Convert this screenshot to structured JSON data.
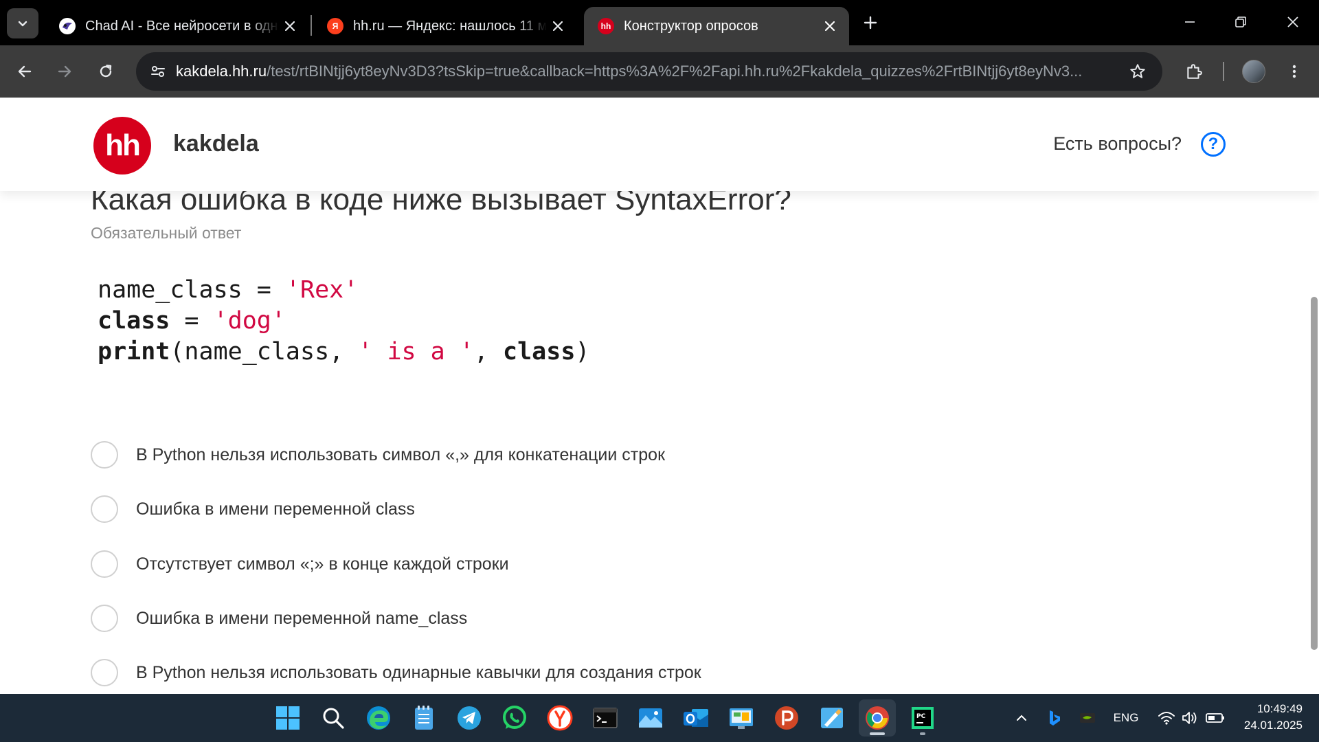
{
  "browser": {
    "tabs": [
      {
        "title": "Chad AI - Все нейросети в одн",
        "favicon": "chad-ai-icon",
        "active": false
      },
      {
        "title": "hh.ru — Яндекс: нашлось 11 м",
        "favicon": "yandex-icon",
        "favicon_text": "Я",
        "active": false
      },
      {
        "title": "Конструктор опросов",
        "favicon": "hh-icon",
        "favicon_text": "hh",
        "active": true
      }
    ],
    "url_host": "kakdela.hh.ru",
    "url_path": "/test/rtBINtjj6yt8eyNv3D3?tsSkip=true&callback=https%3A%2F%2Fapi.hh.ru%2Fkakdela_quizzes%2FrtBINtjj6yt8eyNv3..."
  },
  "site": {
    "logo_text": "hh",
    "name": "kakdela",
    "help_text": "Есть вопросы?",
    "help_icon": "?"
  },
  "question": {
    "title": "Какая ошибка в коде ниже вызывает SyntaxError?",
    "subtitle": "Обязательный ответ",
    "code_lines": [
      [
        {
          "t": "name_class = ",
          "k": "plain"
        },
        {
          "t": "'Rex'",
          "k": "str"
        }
      ],
      [
        {
          "t": "class",
          "k": "kw"
        },
        {
          "t": " = ",
          "k": "plain"
        },
        {
          "t": "'dog'",
          "k": "str"
        }
      ],
      [
        {
          "t": "print",
          "k": "kw"
        },
        {
          "t": "(name_class, ",
          "k": "plain"
        },
        {
          "t": "' is a '",
          "k": "str"
        },
        {
          "t": ", ",
          "k": "plain"
        },
        {
          "t": "class",
          "k": "kw"
        },
        {
          "t": ")",
          "k": "plain"
        }
      ]
    ],
    "options": [
      "В Python нельзя использовать символ «,» для конкатенации строк",
      "Ошибка в имени переменной class",
      "Отсутствует символ «;» в конце каждой строки",
      "Ошибка в имени переменной name_class",
      "В Python нельзя использовать одинарные кавычки для создания строк"
    ]
  },
  "taskbar": {
    "apps": [
      "start-icon",
      "search-icon",
      "edge-icon",
      "notepad-icon",
      "telegram-icon",
      "whatsapp-icon",
      "yandex-browser-icon",
      "terminal-icon",
      "photos-icon",
      "outlook-icon",
      "control-panel-icon",
      "powerpoint-icon",
      "paint-icon",
      "chrome-icon",
      "pycharm-icon"
    ],
    "active_app": "chrome-icon",
    "language": "ENG",
    "time": "10:49:49",
    "date": "24.01.2025"
  },
  "colors": {
    "hh_red": "#d6001c",
    "accent_blue": "#0070ff",
    "code_string": "#d10842",
    "taskbar": "#1c2a38"
  }
}
